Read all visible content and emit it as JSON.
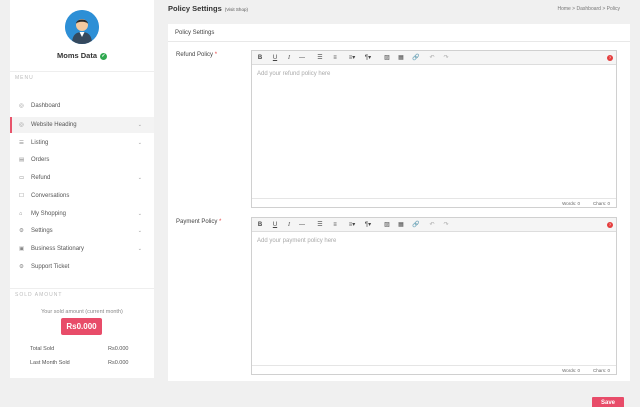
{
  "sidebar": {
    "shop_name": "Moms Data",
    "menu_heading": "MENU",
    "items": [
      {
        "label": "Dashboard",
        "icon": "dashboard-icon",
        "glyph": "◎",
        "chevron": false
      },
      {
        "label": "Website Heading",
        "icon": "website-icon",
        "glyph": "◎",
        "chevron": true
      },
      {
        "label": "Listing",
        "icon": "listing-icon",
        "glyph": "☰",
        "chevron": true
      },
      {
        "label": "Orders",
        "icon": "orders-icon",
        "glyph": "▤",
        "chevron": false
      },
      {
        "label": "Refund",
        "icon": "refund-icon",
        "glyph": "▭",
        "chevron": true
      },
      {
        "label": "Conversations",
        "icon": "conversations-icon",
        "glyph": "☐",
        "chevron": false
      },
      {
        "label": "My Shopping",
        "icon": "shopping-icon",
        "glyph": "⌂",
        "chevron": true
      },
      {
        "label": "Settings",
        "icon": "settings-icon",
        "glyph": "⚙",
        "chevron": true
      },
      {
        "label": "Business Stationary",
        "icon": "briefcase-icon",
        "glyph": "▣",
        "chevron": true
      },
      {
        "label": "Support Ticket",
        "icon": "support-icon",
        "glyph": "⚙",
        "chevron": false
      }
    ],
    "sold_heading": "SOLD AMOUNT",
    "sold_text": "Your sold amount (current month)",
    "sold_amount": "Rs0.000",
    "total_sold_label": "Total Sold",
    "total_sold_value": "Rs0.000",
    "last_month_label": "Last Month Sold",
    "last_month_value": "Rs0.000"
  },
  "header": {
    "title": "Policy Settings",
    "visit_shop": "(Visit Shop)",
    "breadcrumb": "Home > Dashboard > Policy"
  },
  "panel": {
    "title": "Policy Settings",
    "refund_label": "Refund Policy",
    "refund_placeholder": "Add your refund policy here",
    "payment_label": "Payment Policy",
    "payment_placeholder": "Add your payment policy here",
    "required_mark": "*",
    "words_label": "Words: 0",
    "chars_label": "Chars: 0"
  },
  "toolbar": {
    "bold": "B",
    "underline": "U",
    "italic": "I",
    "hr": "—",
    "ul": "☰",
    "ol": "≡",
    "align": "≡▾",
    "para": "¶▾",
    "image": "▨",
    "table": "▦",
    "link": "🔗",
    "undo": "↶",
    "redo": "↷",
    "help": "?"
  },
  "actions": {
    "save_label": "Save"
  },
  "colors": {
    "accent": "#e84c69",
    "avatar_bg": "#2d8fd6",
    "verified": "#2fa84f"
  }
}
